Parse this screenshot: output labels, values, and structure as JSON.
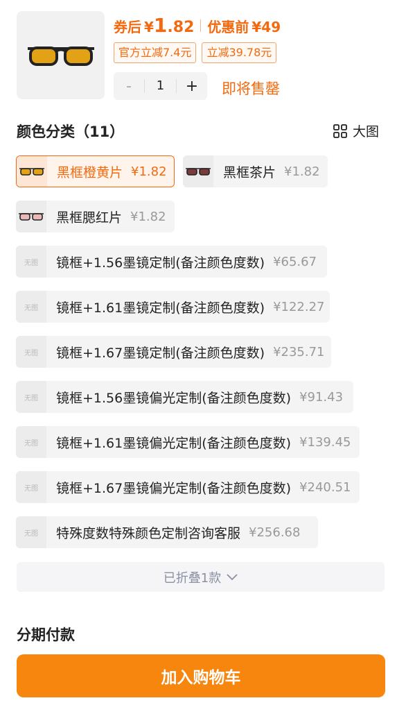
{
  "header": {
    "price_after_coupon_label": "券后",
    "currency": "¥",
    "price_int": "1",
    "price_dec": ".82",
    "before_label": "优惠前",
    "price_before": "¥49",
    "coupons": [
      "官方立减7.4元",
      "立减39.78元"
    ],
    "quantity": "1",
    "minus": "-",
    "plus": "+",
    "stock_status": "即将售罄"
  },
  "colors": {
    "section_title": "颜色分类（11）",
    "big_view_label": "大图",
    "no_image_label": "无图",
    "items": [
      {
        "name": "黑框橙黄片",
        "price": "¥1.82",
        "selected": true
      },
      {
        "name": "黑框茶片",
        "price": "¥1.82"
      },
      {
        "name": "黑框腮红片",
        "price": "¥1.82"
      },
      {
        "name": "镜框+1.56墨镜定制(备注颜色度数)",
        "price": "¥65.67"
      },
      {
        "name": "镜框+1.61墨镜定制(备注颜色度数)",
        "price": "¥122.27"
      },
      {
        "name": "镜框+1.67墨镜定制(备注颜色度数)",
        "price": "¥235.71"
      },
      {
        "name": "镜框+1.56墨镜偏光定制(备注颜色度数)",
        "price": "¥91.43"
      },
      {
        "name": "镜框+1.61墨镜偏光定制(备注颜色度数)",
        "price": "¥139.45"
      },
      {
        "name": "镜框+1.67墨镜偏光定制(备注颜色度数)",
        "price": "¥240.51"
      },
      {
        "name": "特殊度数特殊颜色定制咨询客服",
        "price": "¥256.68"
      }
    ],
    "collapsed_label": "已折叠1款"
  },
  "footer": {
    "installment_label": "分期付款",
    "cart_button": "加入购物车"
  },
  "theme": {
    "accent": "#f26a0f",
    "button": "#f7860f"
  }
}
